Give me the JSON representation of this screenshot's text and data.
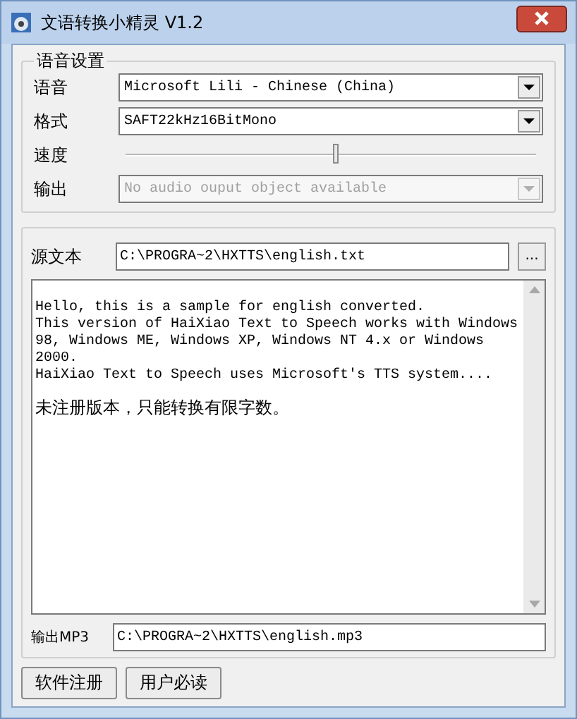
{
  "window": {
    "title": "文语转换小精灵 V1.2"
  },
  "voice_settings": {
    "title": "语音设置",
    "rows": [
      {
        "kind": "combo",
        "label": "语音",
        "value": "Microsoft Lili - Chinese (China)",
        "disabled": false
      },
      {
        "kind": "combo",
        "label": "格式",
        "value": "SAFT22kHz16BitMono",
        "disabled": false
      },
      {
        "kind": "slider",
        "label": "速度",
        "level": 0.51
      },
      {
        "kind": "combo",
        "label": "输出",
        "value": "No audio ouput object available",
        "disabled": true
      }
    ]
  },
  "source": {
    "label": "源文本",
    "value": "C:\\PROGRA~2\\HXTTS\\english.txt",
    "browse_button": "..."
  },
  "text_area": {
    "paragraphs": [
      {
        "lines": [
          "Hello, this is a sample for english converted.",
          "This version of HaiXiao Text to Speech works with Windows",
          "98, Windows ME, Windows XP, Windows NT 4.x or Windows",
          "2000.",
          "HaiXiao Text to Speech uses Microsoft's TTS system...."
        ]
      },
      {
        "lines": [
          "未注册版本，只能转换有限字数。"
        ]
      }
    ]
  },
  "output": {
    "label": "输出MP3",
    "value": "C:\\PROGRA~2\\HXTTS\\english.mp3"
  },
  "buttons": [
    "软件注册",
    "用户必读"
  ]
}
